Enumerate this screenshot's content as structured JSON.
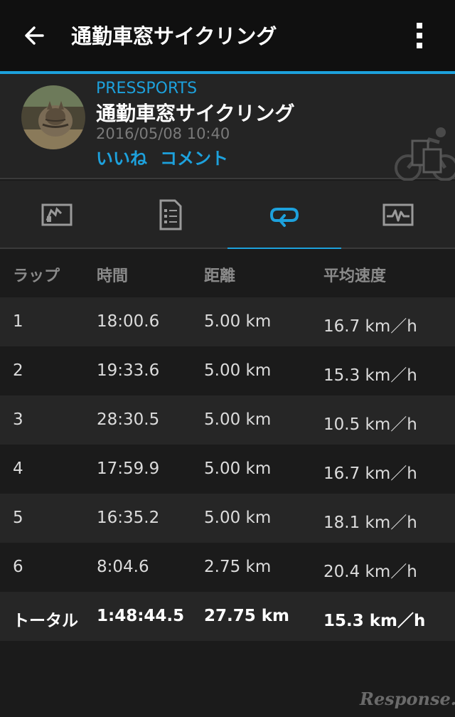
{
  "appbar": {
    "title": "通勤車窓サイクリング"
  },
  "activity": {
    "org": "PRESSPORTS",
    "title": "通勤車窓サイクリング",
    "datetime": "2016/05/08 10:40",
    "like_label": "いいね",
    "comment_label": "コメント"
  },
  "tabs": [
    {
      "icon": "chart-icon",
      "active": false
    },
    {
      "icon": "document-icon",
      "active": false
    },
    {
      "icon": "laps-loop-icon",
      "active": true
    },
    {
      "icon": "pulse-graph-icon",
      "active": false
    }
  ],
  "colors": {
    "accent": "#1da1dc",
    "background": "#1b1b1b"
  },
  "table": {
    "headers": [
      "ラップ",
      "時間",
      "距離",
      "平均速度"
    ],
    "rows": [
      [
        "1",
        "18:00.6",
        "5.00 km",
        "16.7 km／h"
      ],
      [
        "2",
        "19:33.6",
        "5.00 km",
        "15.3 km／h"
      ],
      [
        "3",
        "28:30.5",
        "5.00 km",
        "10.5 km／h"
      ],
      [
        "4",
        "17:59.9",
        "5.00 km",
        "16.7 km／h"
      ],
      [
        "5",
        "16:35.2",
        "5.00 km",
        "18.1 km／h"
      ],
      [
        "6",
        "8:04.6",
        "2.75 km",
        "20.4 km／h"
      ]
    ],
    "total": [
      "トータル",
      "1:48:44.5",
      "27.75 km",
      "15.3 km／h"
    ]
  },
  "watermark": "Response."
}
